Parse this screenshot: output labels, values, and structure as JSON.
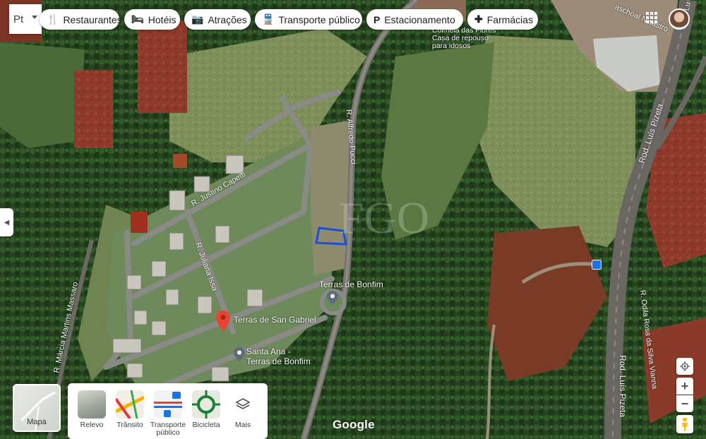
{
  "search": {
    "text": "Pt"
  },
  "filters": [
    {
      "label": "Restaurantes",
      "icon": "🍴",
      "name": "restaurants"
    },
    {
      "label": "Hotéis",
      "icon": "🛏",
      "name": "hotels"
    },
    {
      "label": "Atrações",
      "icon": "📷",
      "name": "attractions"
    },
    {
      "label": "Transporte público",
      "icon": "🚆",
      "name": "public-transport"
    },
    {
      "label": "Estacionamento",
      "icon": "P",
      "name": "parking"
    },
    {
      "label": "Farmácias",
      "icon": "✚",
      "name": "pharmacies"
    }
  ],
  "map": {
    "streets": {
      "alfredo_pucci": "R. Alfredo Pucci",
      "justino_capetti": "R. Justino Capetti",
      "juliana_issa": "R. Juliana Issa",
      "marcia_martins_massaro": "R. Márcia Martins Massaro",
      "luis_pizeta_top": "Rod. Luís Pizeta",
      "luis_pizeta_bottom": "Rod. Luís Pizeta",
      "odila_rosa": "R. Odila Rosa da Silva Vianna",
      "pascoal": "aschoal Nicastro",
      "rod_top": "Rod. Lu"
    },
    "places": {
      "terras_bonfim": "Terras de Bonfim",
      "terras_san_gabriel": "Terras de San Gabriel",
      "santa_ana_1": "Santa Ana -",
      "santa_ana_2": "Terras de Bonfim",
      "comeia_1": "Colmeia das Flores",
      "comeia_2": "Casa de repouso",
      "comeia_3": "para idosos"
    },
    "colors": {
      "selection": "#1a4fd6",
      "pin": "#ea4335"
    }
  },
  "mapa_button": {
    "label": "Mapa"
  },
  "layers": [
    {
      "label": "Relevo",
      "name": "terrain"
    },
    {
      "label": "Trânsito",
      "name": "traffic"
    },
    {
      "label": "Transporte público",
      "name": "transit"
    },
    {
      "label": "Bicicleta",
      "name": "bicycle"
    },
    {
      "label": "Mais",
      "name": "more"
    }
  ],
  "controls": {
    "zoom_in": "+",
    "zoom_out": "−"
  },
  "brand": "Google"
}
